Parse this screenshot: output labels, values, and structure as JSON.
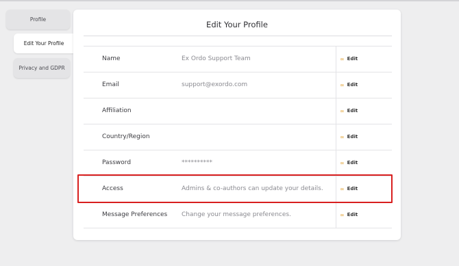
{
  "tabs": [
    {
      "label": "Profile",
      "active": false
    },
    {
      "label": "Edit Your Profile",
      "active": true
    },
    {
      "label": "Privacy and GDPR",
      "active": false
    }
  ],
  "card": {
    "title": "Edit Your Profile"
  },
  "rows": [
    {
      "label": "Name",
      "value": "Ex Ordo Support Team",
      "action": "Edit"
    },
    {
      "label": "Email",
      "value": "support@exordo.com",
      "action": "Edit"
    },
    {
      "label": "Affiliation",
      "value": "",
      "action": "Edit"
    },
    {
      "label": "Country/Region",
      "value": "",
      "action": "Edit"
    },
    {
      "label": "Password",
      "value": "**********",
      "action": "Edit"
    },
    {
      "label": "Access",
      "value": "Admins & co-authors can update your details.",
      "action": "Edit"
    },
    {
      "label": "Message Preferences",
      "value": "Change your message preferences.",
      "action": "Edit"
    }
  ],
  "highlighted_row": "Access",
  "colors": {
    "accent_icon": "#e2a53a",
    "highlight": "#d81e1e",
    "background": "#eeeeef"
  },
  "icons": {
    "edit": "link-icon"
  }
}
